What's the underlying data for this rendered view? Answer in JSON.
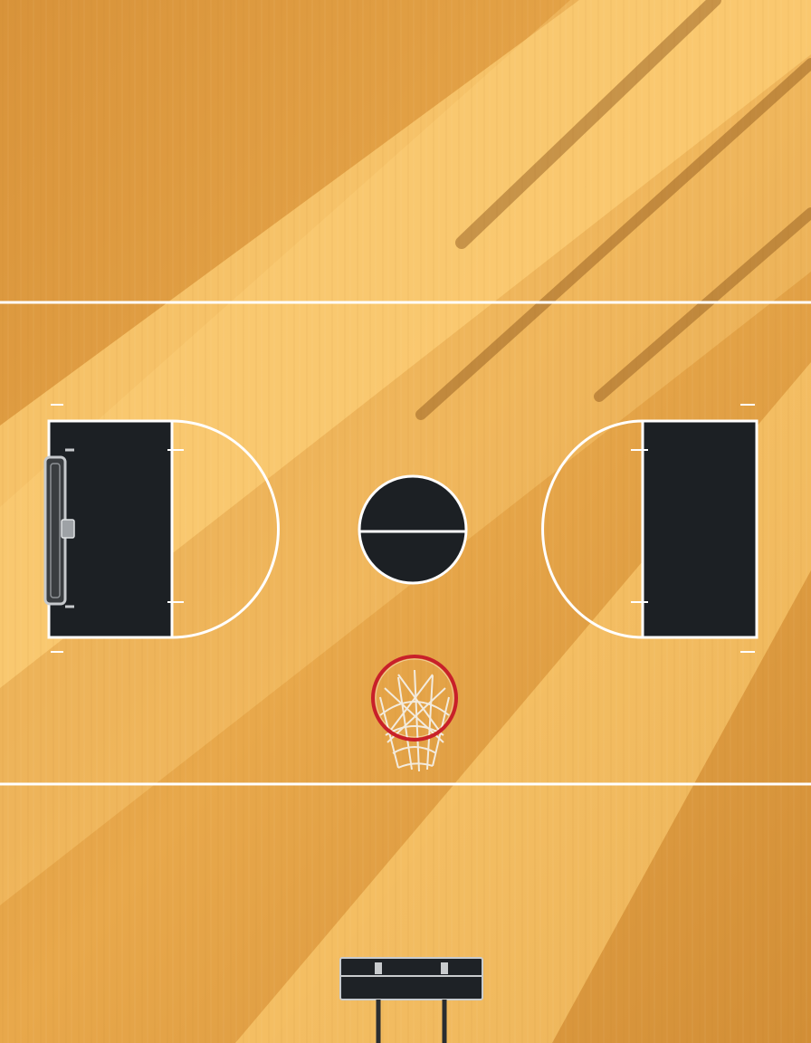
{
  "scene": {
    "description_type": "overhead-photo-illustration",
    "colors": {
      "wood_light": "#f2b95a",
      "wood_mid": "#e2a043",
      "wood_shadow": "#c9852e",
      "paint": "#1c2024",
      "line": "#ffffff",
      "rim": "#c8202a",
      "net": "#f4efe6",
      "metal": "#b9bcbf"
    },
    "icons": {
      "backboard": "backboard-icon",
      "hoop": "hoop-icon",
      "bench": "bench-icon"
    }
  }
}
